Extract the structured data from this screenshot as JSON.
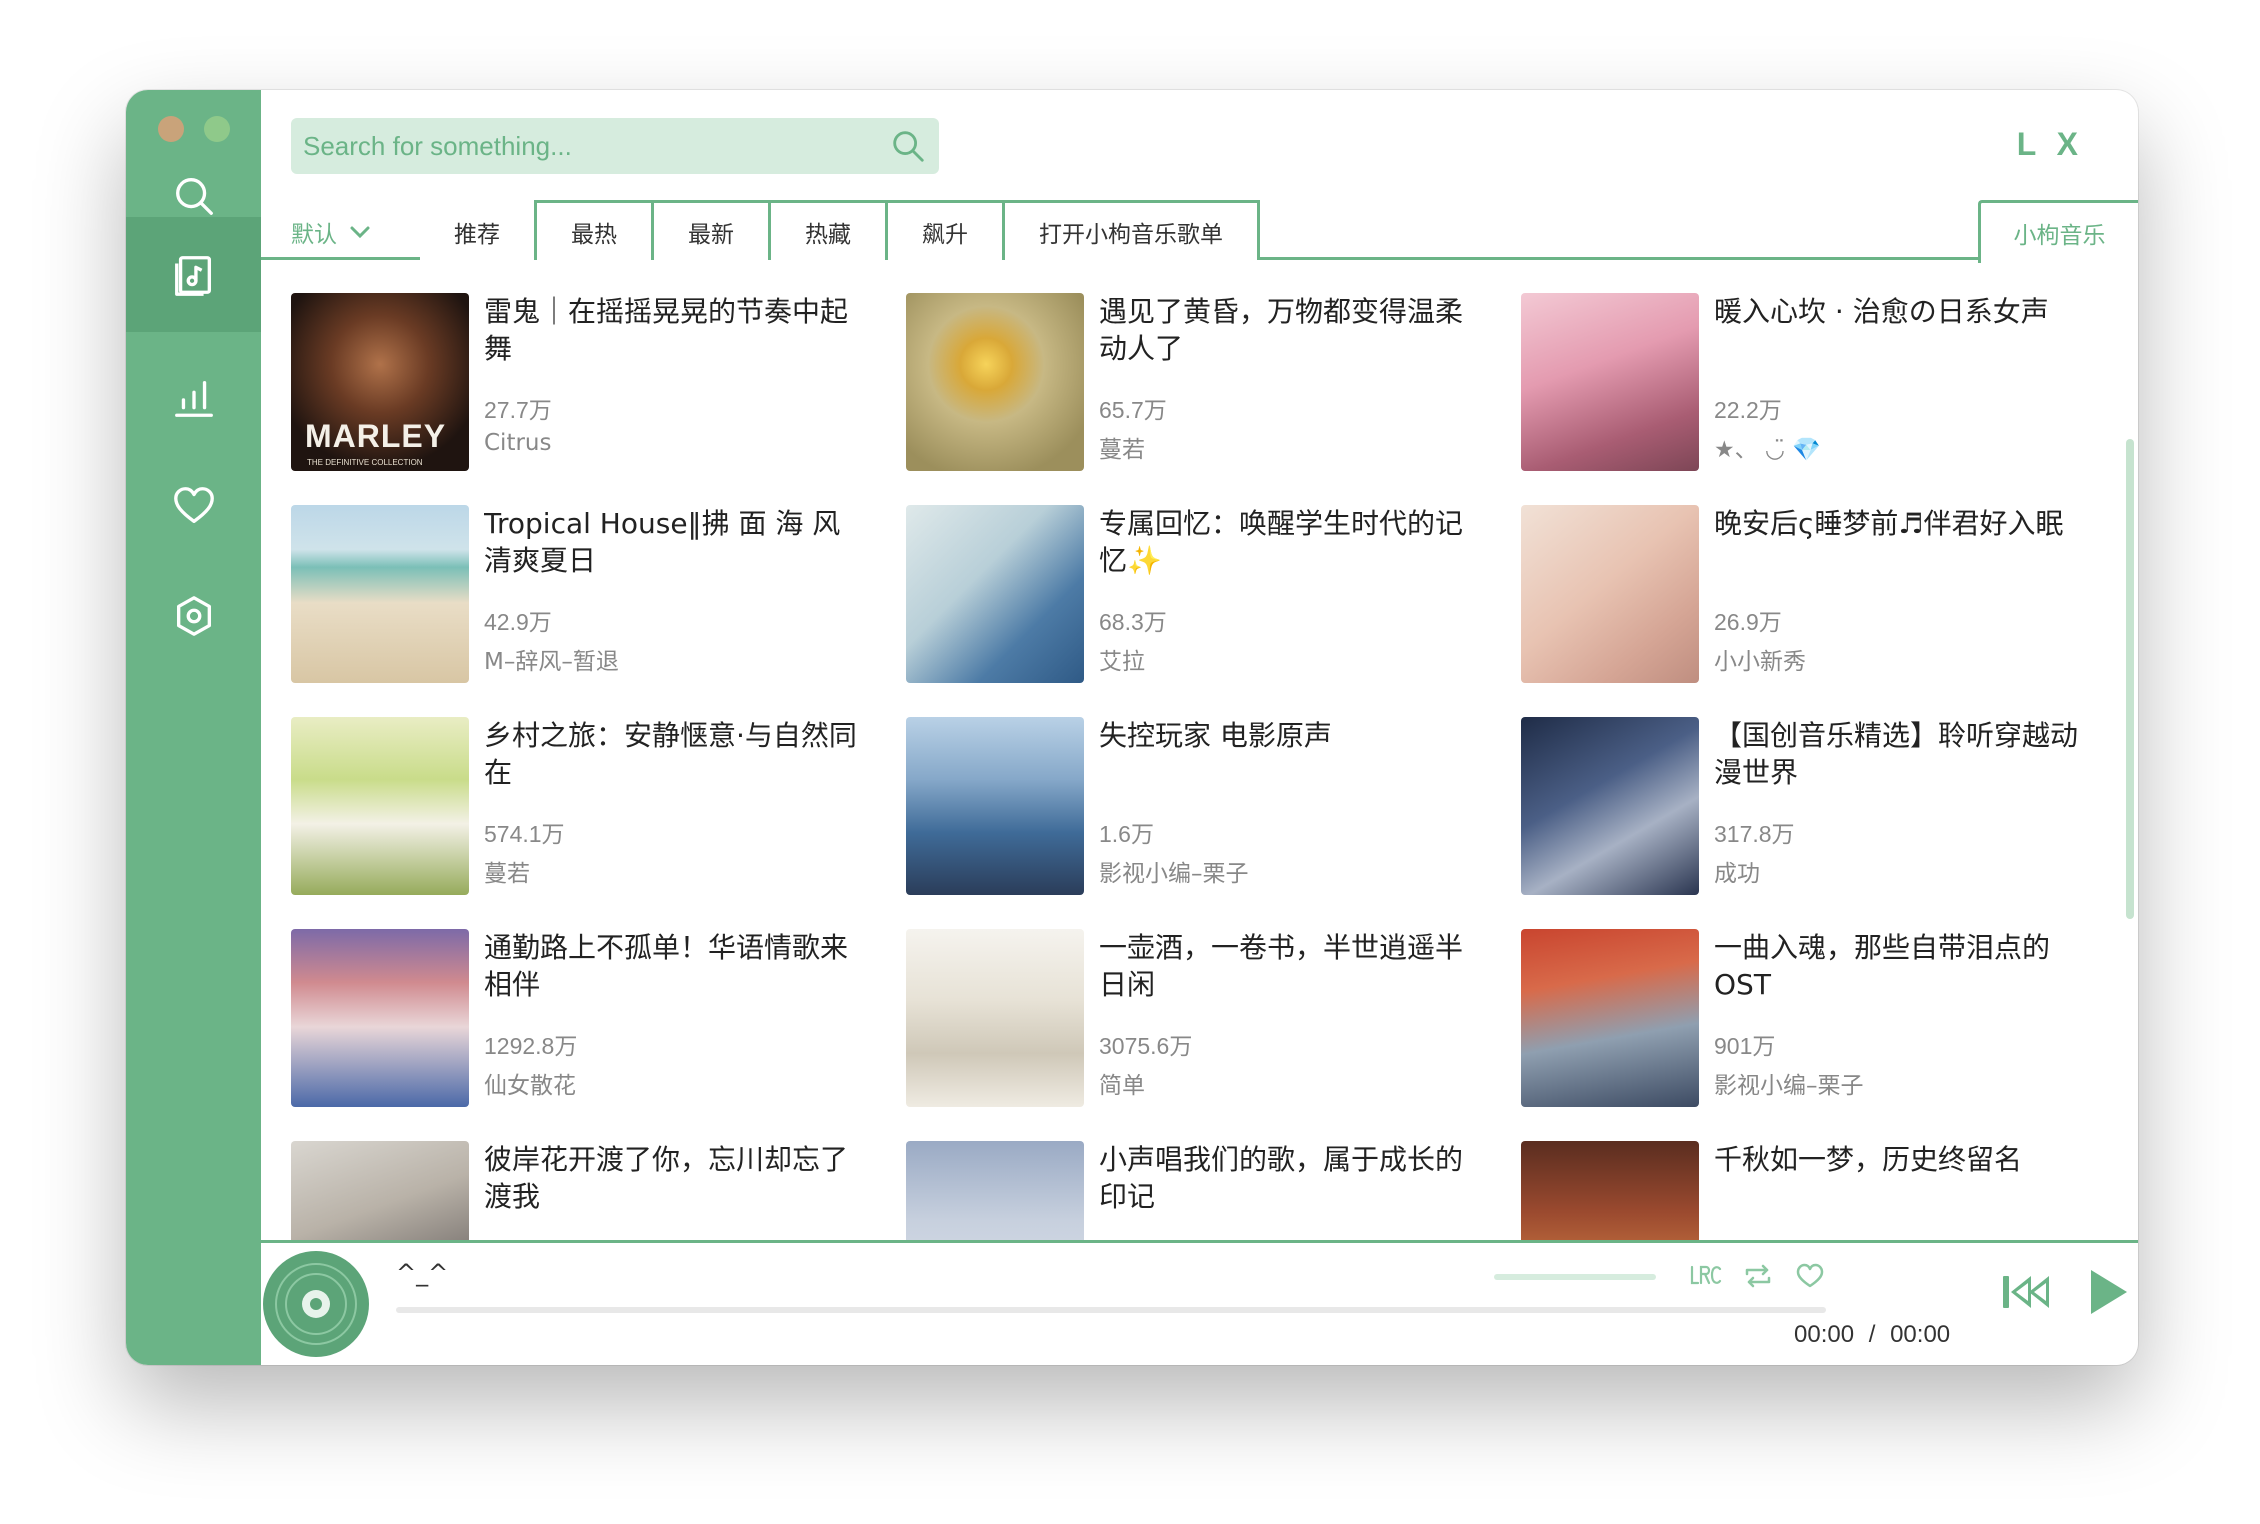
{
  "window": {
    "logo": "L X"
  },
  "sidebar": {
    "items": [
      {
        "icon": "search-icon",
        "active": false
      },
      {
        "icon": "music-list-icon",
        "active": true
      },
      {
        "icon": "leaderboard-icon",
        "active": false
      },
      {
        "icon": "heart-icon",
        "active": false
      },
      {
        "icon": "settings-icon",
        "active": false
      }
    ]
  },
  "search": {
    "placeholder": "Search for something..."
  },
  "sort": {
    "label": "默认"
  },
  "tabs": [
    {
      "label": "推荐",
      "active": true
    },
    {
      "label": "最热",
      "active": false
    },
    {
      "label": "最新",
      "active": false
    },
    {
      "label": "热藏",
      "active": false
    },
    {
      "label": "飙升",
      "active": false
    },
    {
      "label": "打开小枸音乐歌单",
      "active": false
    }
  ],
  "source_tab": {
    "label": "小枸音乐"
  },
  "playlists": [
    {
      "title": "雷鬼｜在摇摇晃晃的节奏中起舞",
      "count": "27.7万",
      "author": "Citrus",
      "cover_text": "MARLEY",
      "cover_sub": "THE DEFINITIVE COLLECTION"
    },
    {
      "title": "遇见了黄昏，万物都变得温柔动人了",
      "count": "65.7万",
      "author": "蔓若"
    },
    {
      "title": "暖入心坎 · 治愈の日系女声",
      "count": "22.2万",
      "author": "★、 ◡̈ 💎"
    },
    {
      "title": "Tropical House‖拂 面 海 风 清爽夏日",
      "count": "42.9万",
      "author": "M–辞风–暂退"
    },
    {
      "title": "专属回忆：唤醒学生时代的记忆✨",
      "count": "68.3万",
      "author": "艾拉"
    },
    {
      "title": "晚安后ς睡梦前♬伴君好入眠",
      "count": "26.9万",
      "author": "小小新秀"
    },
    {
      "title": "乡村之旅：安静惬意·与自然同在",
      "count": "574.1万",
      "author": "蔓若"
    },
    {
      "title": "失控玩家 电影原声",
      "count": "1.6万",
      "author": "影视小编–栗子"
    },
    {
      "title": "【国创音乐精选】聆听穿越动漫世界",
      "count": "317.8万",
      "author": "成功"
    },
    {
      "title": "通勤路上不孤单！华语情歌来相伴",
      "count": "1292.8万",
      "author": "仙女散花"
    },
    {
      "title": "一壶酒，一卷书，半世逍遥半日闲",
      "count": "3075.6万",
      "author": "简单"
    },
    {
      "title": "一曲入魂，那些自带泪点的OST",
      "count": "901万",
      "author": "影视小编–栗子"
    },
    {
      "title": "彼岸花开渡了你，忘川却忘了渡我",
      "count": "",
      "author": ""
    },
    {
      "title": "小声唱我们的歌，属于成长的印记",
      "count": "",
      "author": ""
    },
    {
      "title": "千秋如一梦，历史终留名",
      "count": "",
      "author": ""
    }
  ],
  "player": {
    "song": "^_^",
    "time_current": "00:00",
    "time_separator": "/",
    "time_total": "00:00",
    "progress": 0
  },
  "colors": {
    "accent": "#6bb487",
    "accent_dark": "#5ca478",
    "search_bg": "#d6ecde"
  }
}
